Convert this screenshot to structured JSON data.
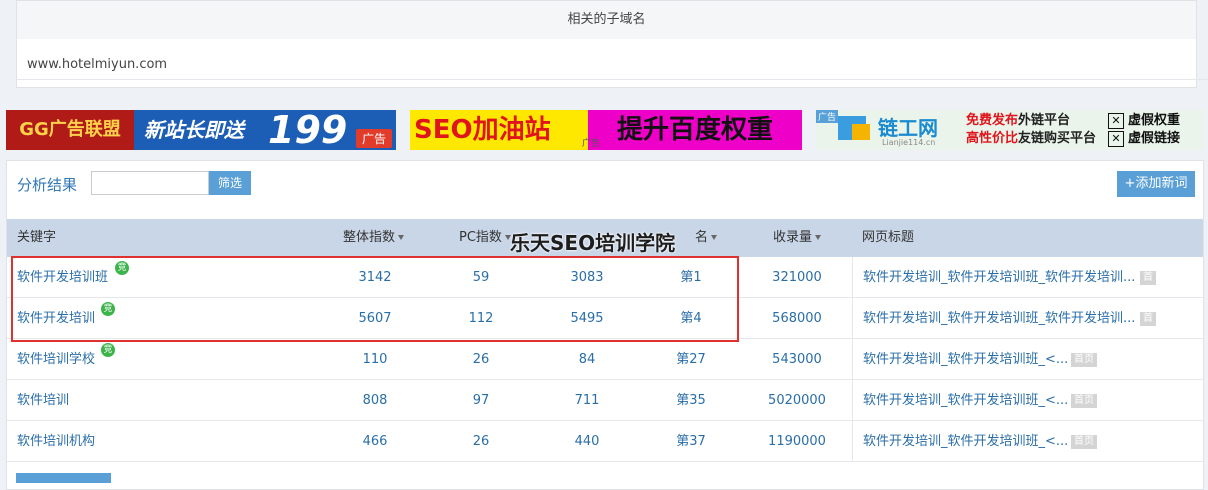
{
  "subdomain_panel": {
    "header": "相关的子域名",
    "domains": [
      "www.hotelmiyun.com"
    ]
  },
  "ads": {
    "ad1": {
      "brand": "GG广告联盟",
      "text": "新站长即送",
      "number": "199",
      "tag": "广告"
    },
    "ad2": {
      "left": "SEO加油站",
      "right": "提升百度权重",
      "small": "广告"
    },
    "ad3": {
      "tag": "广告",
      "brand": "链工网",
      "domain": "Lianjie114.cn",
      "line1_red": "免费发布",
      "line1_dark": "外链平台",
      "line2_red": "高性价比",
      "line2_dark": "友链购买平台",
      "x1": "虚假权重",
      "x2": "虚假链接"
    }
  },
  "results": {
    "title": "分析结果",
    "filter_placeholder": "",
    "filter_button": "筛选",
    "add_button": "+添加新词",
    "columns": {
      "keyword": "关键字",
      "total": "整体指数",
      "pc": "PC指数",
      "rank": "名",
      "indexed": "收录量",
      "page_title": "网页标题"
    },
    "watermark": "乐天SEO培训学院",
    "rows": [
      {
        "keyword": "软件开发培训班",
        "badge": "竞",
        "total": "3142",
        "pc": "59",
        "mobile": "3083",
        "rank": "第1",
        "indexed": "321000",
        "page_title": "软件开发培训_软件开发培训班_软件开发培训...",
        "home": "首"
      },
      {
        "keyword": "软件开发培训",
        "badge": "竞",
        "total": "5607",
        "pc": "112",
        "mobile": "5495",
        "rank": "第4",
        "indexed": "568000",
        "page_title": "软件开发培训_软件开发培训班_软件开发培训...",
        "home": "首"
      },
      {
        "keyword": "软件培训学校",
        "badge": "竞",
        "total": "110",
        "pc": "26",
        "mobile": "84",
        "rank": "第27",
        "indexed": "543000",
        "page_title": "软件开发培训_软件开发培训班_<...",
        "home": "首页"
      },
      {
        "keyword": "软件培训",
        "badge": "",
        "total": "808",
        "pc": "97",
        "mobile": "711",
        "rank": "第35",
        "indexed": "5020000",
        "page_title": "软件开发培训_软件开发培训班_<...",
        "home": "首页"
      },
      {
        "keyword": "软件培训机构",
        "badge": "",
        "total": "466",
        "pc": "26",
        "mobile": "440",
        "rank": "第37",
        "indexed": "1190000",
        "page_title": "软件开发培训_软件开发培训班_<...",
        "home": "首页"
      }
    ]
  },
  "colors": {
    "link": "#2a6ea8",
    "header_bg": "#c9d6e8",
    "button": "#5aa0d6",
    "highlight": "#e03131",
    "badge": "#3cb44a"
  }
}
